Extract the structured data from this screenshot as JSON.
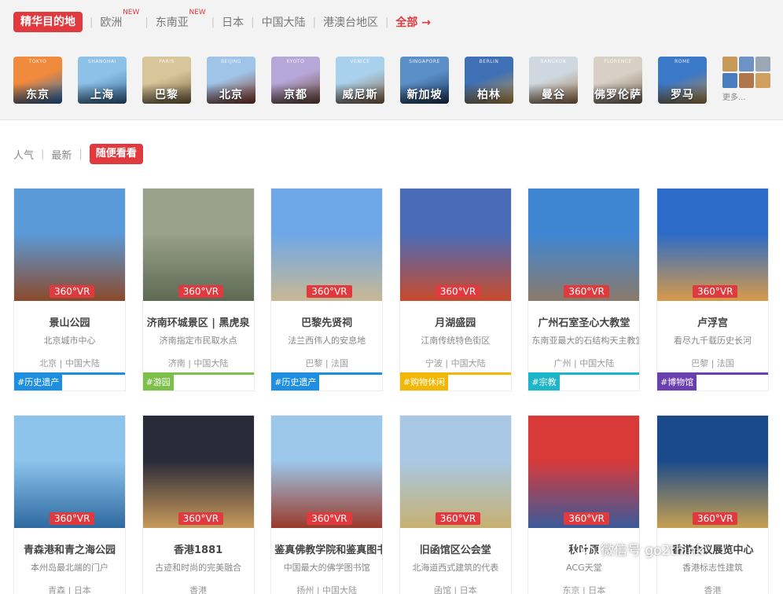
{
  "regions": {
    "active": "精华目的地",
    "items": [
      {
        "label": "欧洲",
        "badge": "NEW"
      },
      {
        "label": "东南亚",
        "badge": "NEW"
      },
      {
        "label": "日本",
        "badge": ""
      },
      {
        "label": "中国大陆",
        "badge": ""
      },
      {
        "label": "港澳台地区",
        "badge": ""
      }
    ],
    "all": "全部 →"
  },
  "cities": [
    {
      "en": "TOKYO",
      "cn": "东京",
      "c1": "#f08a3c",
      "c2": "#2a6fb8"
    },
    {
      "en": "SHANGHAI",
      "cn": "上海",
      "c1": "#8ec1e8",
      "c2": "#356c9a"
    },
    {
      "en": "PARIS",
      "cn": "巴黎",
      "c1": "#d9c59a",
      "c2": "#7f6a46"
    },
    {
      "en": "BEIJING",
      "cn": "北京",
      "c1": "#9fc4e8",
      "c2": "#8a3b2a"
    },
    {
      "en": "KYOTO",
      "cn": "京都",
      "c1": "#b7a6d8",
      "c2": "#6d4a3c"
    },
    {
      "en": "VENICE",
      "cn": "威尼斯",
      "c1": "#a9d0ec",
      "c2": "#8c6b4a"
    },
    {
      "en": "SINGAPORE",
      "cn": "新加坡",
      "c1": "#5b8fc8",
      "c2": "#1d3c64"
    },
    {
      "en": "BERLIN",
      "cn": "柏林",
      "c1": "#3f6fb4",
      "c2": "#c79a4a"
    },
    {
      "en": "BANGKOK",
      "cn": "曼谷",
      "c1": "#cfd8e0",
      "c2": "#a07a52"
    },
    {
      "en": "FLORENCE",
      "cn": "佛罗伦萨",
      "c1": "#d8d0c4",
      "c2": "#7a6a5c"
    },
    {
      "en": "ROME",
      "cn": "罗马",
      "c1": "#3a78c8",
      "c2": "#b58d4c"
    }
  ],
  "more": {
    "label": "更多...",
    "colors": [
      "#c89a5a",
      "#6d93c4",
      "#9aa8b6",
      "#4a7cc0",
      "#b0764c",
      "#d0a060"
    ]
  },
  "sort": {
    "items": [
      "人气",
      "最新"
    ],
    "active": "随便看看"
  },
  "vr_label": "360°VR",
  "cards": [
    {
      "title": "景山公园",
      "subtitle": "北京城市中心",
      "location": "北京 | 中国大陆",
      "tag": "#历史遗产",
      "tag_color": "#1e8fe0",
      "c1": "#5b9ad8",
      "c2": "#8a4a2a"
    },
    {
      "title": "济南环城景区 | 黑虎泉",
      "subtitle": "济南指定市民取水点",
      "location": "济南 | 中国大陆",
      "tag": "#游园",
      "tag_color": "#7cc04a",
      "c1": "#9aa08a",
      "c2": "#5c6a54"
    },
    {
      "title": "巴黎先贤祠",
      "subtitle": "法兰西伟人的安息地",
      "location": "巴黎 | 法国",
      "tag": "#历史遗产",
      "tag_color": "#1e8fe0",
      "c1": "#6ea8e8",
      "c2": "#c8b894"
    },
    {
      "title": "月湖盛园",
      "subtitle": "江南传统特色街区",
      "location": "宁波 | 中国大陆",
      "tag": "#购物休闲",
      "tag_color": "#f2b705",
      "c1": "#4a6cb8",
      "c2": "#c84a2a"
    },
    {
      "title": "广州石室圣心大教堂",
      "subtitle": "东南亚最大的石结构天主教堂",
      "location": "广州 | 中国大陆",
      "tag": "#宗教",
      "tag_color": "#1db6c8",
      "c1": "#3e86d4",
      "c2": "#8a7a6a"
    },
    {
      "title": "卢浮宫",
      "subtitle": "看尽九千载历史长河",
      "location": "巴黎 | 法国",
      "tag": "#博物馆",
      "tag_color": "#6a3fb0",
      "c1": "#2c6cc8",
      "c2": "#d89a4a"
    },
    {
      "title": "青森港和青之海公园",
      "subtitle": "本州岛最北端的门户",
      "location": "青森 | 日本",
      "tag": "",
      "tag_color": "",
      "c1": "#8cc4ec",
      "c2": "#2e6aa0"
    },
    {
      "title": "香港1881",
      "subtitle": "古迹和时尚的完美融合",
      "location": "香港",
      "tag": "",
      "tag_color": "",
      "c1": "#2a2a3a",
      "c2": "#c89a5a"
    },
    {
      "title": "鉴真佛教学院和鉴真图书馆",
      "subtitle": "中国最大的佛学图书馆",
      "location": "扬州 | 中国大陆",
      "tag": "",
      "tag_color": "",
      "c1": "#9cc8ec",
      "c2": "#9a3a2a"
    },
    {
      "title": "旧函馆区公会堂",
      "subtitle": "北海道西式建筑的代表",
      "location": "函馆 | 日本",
      "tag": "",
      "tag_color": "",
      "c1": "#a8c8e4",
      "c2": "#c8b070"
    },
    {
      "title": "秋叶原",
      "subtitle": "ACG天堂",
      "location": "东京 | 日本",
      "tag": "",
      "tag_color": "",
      "c1": "#d83a3a",
      "c2": "#3a5a9a"
    },
    {
      "title": "香港会议展览中心",
      "subtitle": "香港标志性建筑",
      "location": "香港",
      "tag": "",
      "tag_color": "",
      "c1": "#1a4a8a",
      "c2": "#c8a050"
    }
  ],
  "watermark": "微信号 go2think"
}
